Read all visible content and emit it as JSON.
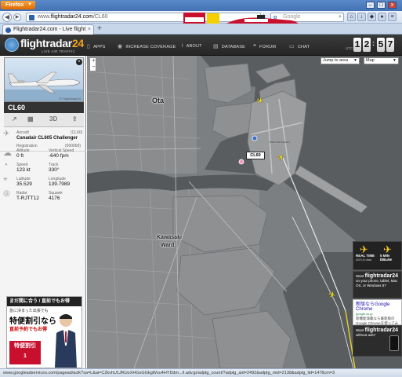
{
  "browser": {
    "menu_button": "Firefox",
    "url_prefix": "www.",
    "url_host": "flightradar24.com",
    "url_path": "/CL60",
    "search_placeholder": "Google",
    "search_engine_glyph": "g",
    "tab_title": "Flightradar24.com - Live flight trac...",
    "status_url": "www.googleadservices.com/pagead/aclk?sa=L&ai=C2kvhU1JRUoXHGsGGkgWxu4HYDdm.../l.adv.jp/adptg_count/?adptg_aid=2492&adptg_mid=2138&adptg_lid=1478cm=3"
  },
  "header": {
    "logo_text": "flightradar",
    "logo_number": "24",
    "slogan": "LIVE AIR TRAFFIC",
    "nav": [
      {
        "label": "APPS",
        "icon": "phone-icon"
      },
      {
        "label": "INCREASE COVERAGE",
        "icon": "eye-icon"
      },
      {
        "label": "ABOUT",
        "icon": "info-icon"
      },
      {
        "label": "DATABASE",
        "icon": "database-icon"
      },
      {
        "label": "FORUM",
        "icon": "chat-bubbles-icon"
      },
      {
        "label": "CHAT",
        "icon": "chat-icon"
      }
    ],
    "utc_label": "UTC",
    "clock": [
      "1",
      "2",
      "5",
      "7"
    ]
  },
  "sidebar": {
    "photo_credit": "© Flightradar24",
    "callsign": "CL60",
    "tool_3d": "3D",
    "aircraft_label": "Aircraft",
    "aircraft_code": "(CL60)",
    "aircraft_name": "Canadair CL605 Challenger",
    "registration_label": "Registration",
    "registration_value": "(000000)",
    "altitude_label": "Altitude",
    "altitude_value": "0 ft",
    "vspeed_label": "Vertical Speed",
    "vspeed_value": "-640 fpm",
    "speed_label": "Speed",
    "speed_value": "123 kt",
    "track_label": "Track",
    "track_value": "330°",
    "lat_label": "Latitude",
    "lat_value": "35.529",
    "lon_label": "Longitude",
    "lon_value": "139.7989",
    "radar_label": "Radar",
    "radar_value": "T-RJTT12",
    "squawk_label": "Squawk",
    "squawk_value": "4176"
  },
  "ad_left": {
    "title": "まだ間に合う / 直前でもお得",
    "line1": "急に決まった出張でも",
    "line2": "特便割引なら",
    "line3": "直前予約でもお得",
    "box": "特便割引",
    "box_sub": "1"
  },
  "map": {
    "zoom_in": "+",
    "zoom_out": "−",
    "jump_label": "Jump to area",
    "map_type": "Map",
    "label_ota": "Ota",
    "label_kawasaki": "Kawasaki",
    "label_ward": "Ward",
    "label_haneda": "Haneda Airport",
    "flight_tag": "CL60"
  },
  "ads_right": {
    "rt_title1": "REAL TIME",
    "rt_title2": "5 MIN DELAY",
    "rt_sub1": "ADS-B data",
    "rt_sub2": "FAA data",
    "want1_pre": "Want",
    "want1_big": "flightradar24",
    "want1_rest": "on your phone, tablet, Mac OS, or Windows 8?",
    "chrome_title": "新版ならGoogle Chrome",
    "chrome_url": "google.co.jp",
    "chrome_text": "新機能満載なら最新版のGoogle Chromeを使ってみよう",
    "want2_pre": "Want",
    "want2_big": "flightradar24",
    "want2_rest": "without ads?"
  }
}
